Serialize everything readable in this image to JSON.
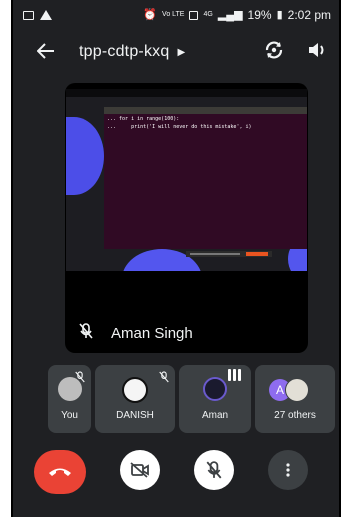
{
  "status_bar": {
    "battery": "19%",
    "time": "2:02 pm",
    "network": "4G"
  },
  "appbar": {
    "title": "tpp-cdtp-kxq"
  },
  "main_tile": {
    "presenter_name": "Aman Singh",
    "shared_screen": {
      "code_line_1": "... for i in range(100):",
      "code_line_2": "...     print('I will never do this mistake', i)"
    }
  },
  "participants": [
    {
      "label": "You",
      "muted": true
    },
    {
      "label": "DANISH",
      "muted": true
    },
    {
      "label": "Aman",
      "speaking": true
    },
    {
      "label": "27 others",
      "avatar_letter": "A"
    }
  ],
  "colors": {
    "background": "#1f2023",
    "tile": "#3c4043",
    "end_call": "#ea4335",
    "accent_purple": "#8e6cef"
  }
}
